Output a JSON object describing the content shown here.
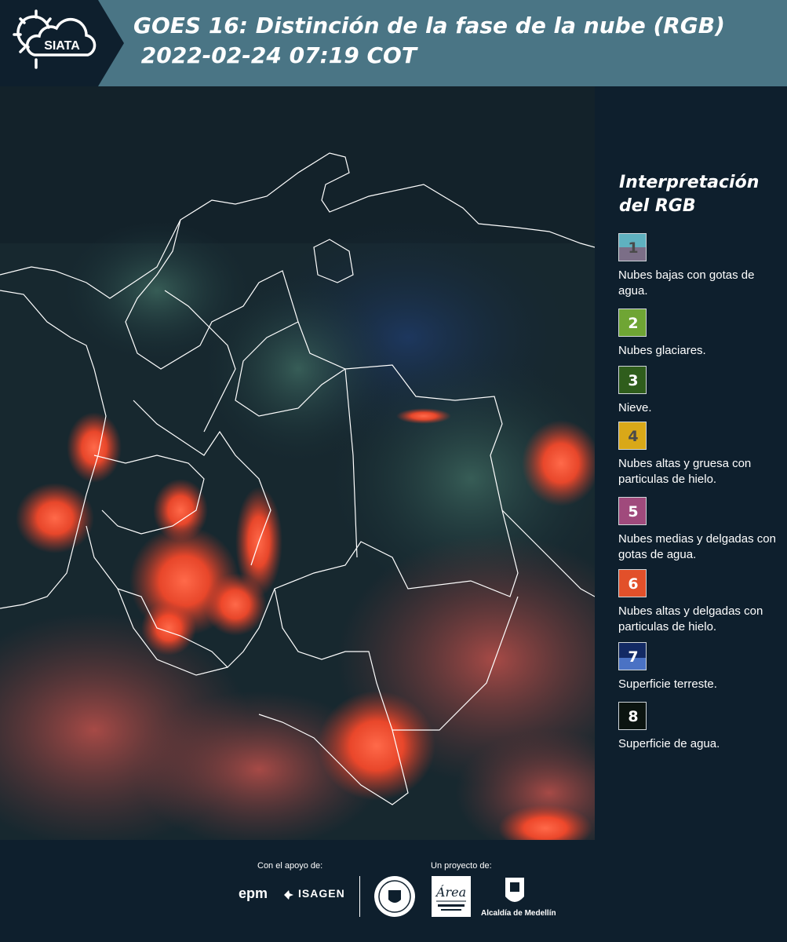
{
  "header": {
    "logo_text": "SIATA",
    "title": "GOES 16: Distinción de la fase de la nube (RGB)\n 2022-02-24 07:19 COT"
  },
  "legend": {
    "title": "Interpretación del RGB",
    "items": [
      {
        "number": "1",
        "label": "Nubes bajas con gotas de agua.",
        "color_top": "#5fb1c0",
        "color_bottom": "#7b6e87",
        "number_color": "#4a4a4a"
      },
      {
        "number": "2",
        "label": "Nubes glaciares.",
        "color_top": "#6fa534",
        "color_bottom": "#6fa534",
        "number_color": "#ffffff"
      },
      {
        "number": "3",
        "label": "Nieve.",
        "color_top": "#2f5d1c",
        "color_bottom": "#2f5d1c",
        "number_color": "#ffffff"
      },
      {
        "number": "4",
        "label": "Nubes altas y gruesa con particulas de hielo.",
        "color_top": "#d9a818",
        "color_bottom": "#d9a818",
        "number_color": "#4a4a4a"
      },
      {
        "number": "5",
        "label": "Nubes medias y delgadas con gotas de agua.",
        "color_top": "#a04a7c",
        "color_bottom": "#a04a7c",
        "number_color": "#ffffff"
      },
      {
        "number": "6",
        "label": "Nubes altas y delgadas con particulas de hielo.",
        "color_top": "#e2502a",
        "color_bottom": "#e2502a",
        "number_color": "#ffffff"
      },
      {
        "number": "7",
        "label": "Superficie terreste.",
        "color_top": "#132a64",
        "color_bottom": "#4a72c4",
        "number_color": "#ffffff"
      },
      {
        "number": "8",
        "label": "Superficie de agua.",
        "color_top": "#0b1410",
        "color_bottom": "#0b1410",
        "number_color": "#ffffff"
      }
    ]
  },
  "footer": {
    "support_label": "Con el apoyo de:",
    "project_label": "Un proyecto de:",
    "epm": "epm",
    "isagen": "ISAGEN",
    "area_logo_text": "Área Metropolitana Valle de Aburrá",
    "alcaldia": "Alcaldía de Medellín"
  },
  "colors": {
    "header_bg": "#4a7585",
    "page_bg": "#0e1f2d",
    "cloud_red": "#ff4a2a"
  }
}
